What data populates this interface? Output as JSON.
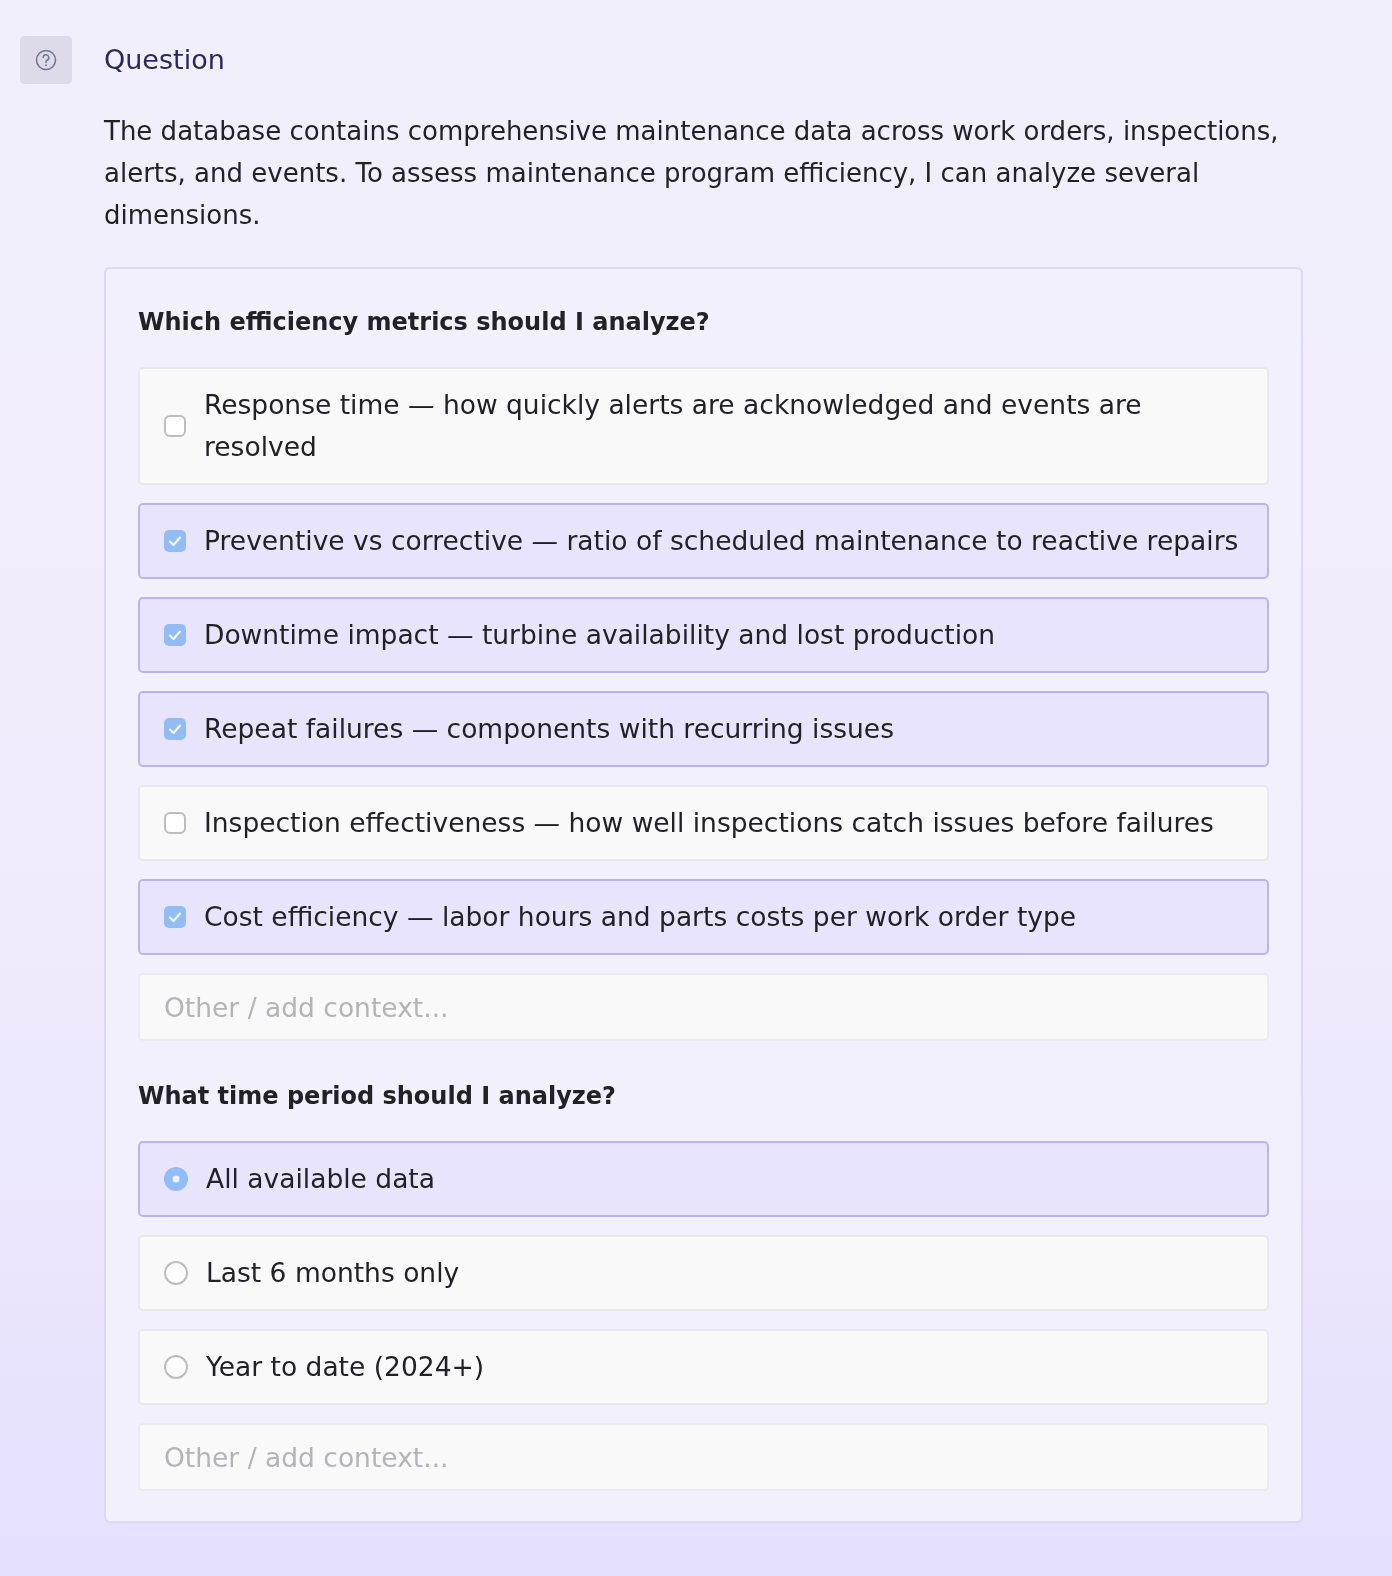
{
  "header": {
    "title": "Question",
    "description": "The database contains comprehensive maintenance data across work orders, inspections, alerts, and events. To assess maintenance program efficiency, I can analyze several dimensions."
  },
  "questions": [
    {
      "prompt": "Which efficiency metrics should I analyze?",
      "kind": "checkbox",
      "options": [
        {
          "label": "Response time — how quickly alerts are acknowledged and events are resolved",
          "checked": false
        },
        {
          "label": "Preventive vs corrective — ratio of scheduled maintenance to reactive repairs",
          "checked": true
        },
        {
          "label": "Downtime impact — turbine availability and lost production",
          "checked": true
        },
        {
          "label": "Repeat failures — components with recurring issues",
          "checked": true
        },
        {
          "label": "Inspection effectiveness — how well inspections catch issues before failures",
          "checked": false
        },
        {
          "label": "Cost efficiency — labor hours and parts costs per work order type",
          "checked": true
        }
      ],
      "other": {
        "placeholder": "Other / add context..."
      }
    },
    {
      "prompt": "What time period should I analyze?",
      "kind": "radio",
      "options": [
        {
          "label": "All available data",
          "selected": true
        },
        {
          "label": "Last 6 months only",
          "selected": false
        },
        {
          "label": "Year to date (2024+)",
          "selected": false
        }
      ],
      "other": {
        "placeholder": "Other / add context..."
      }
    }
  ]
}
